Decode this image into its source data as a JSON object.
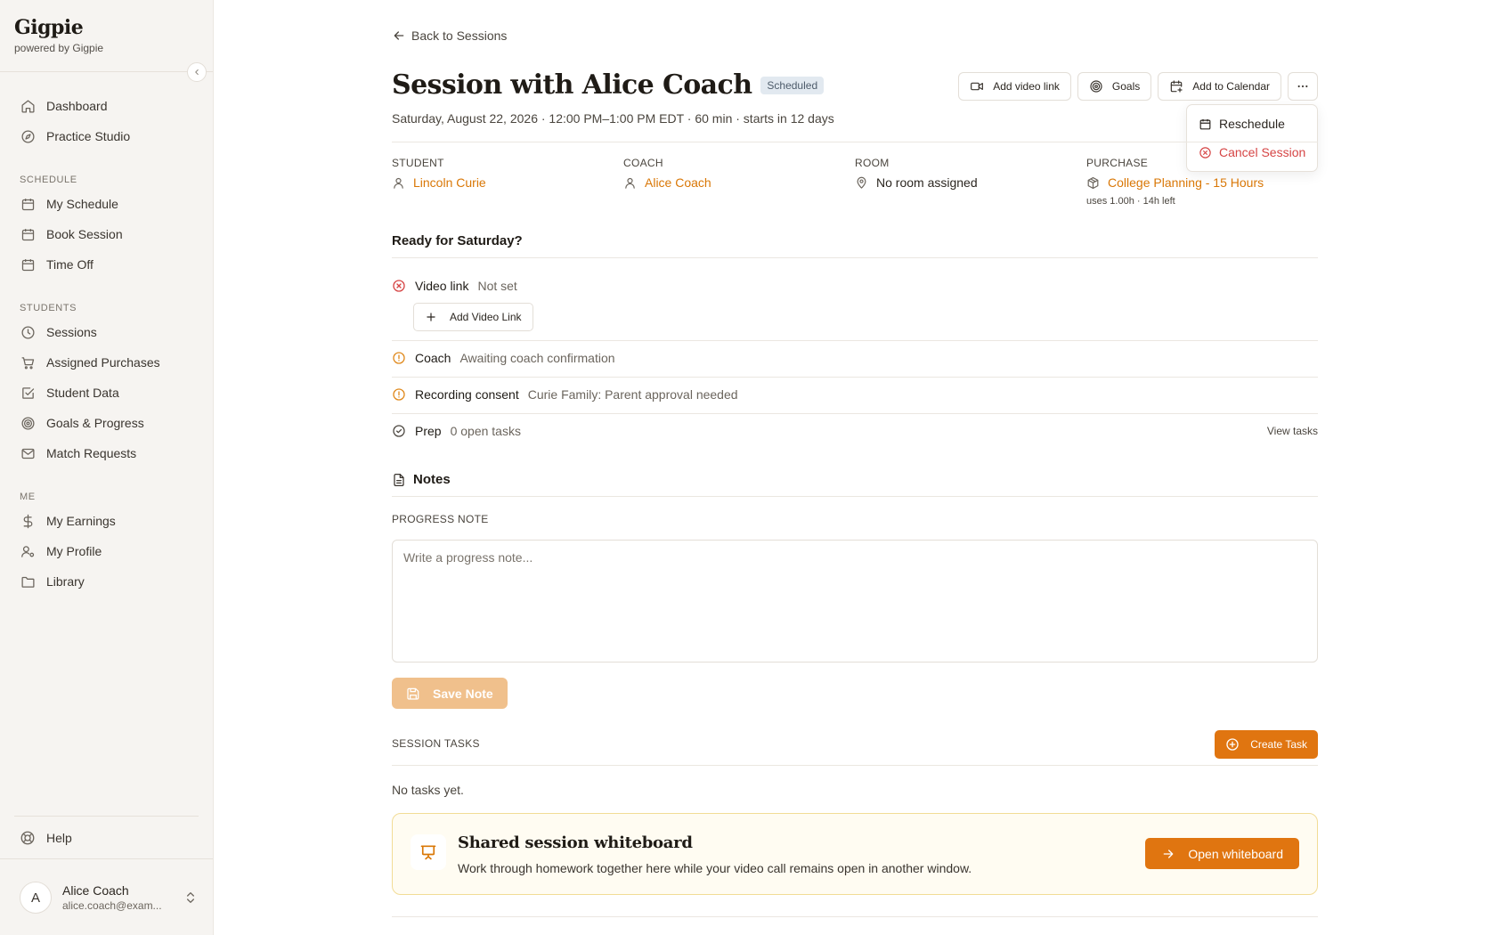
{
  "brand": {
    "name": "Gigpie",
    "sub": "powered by Gigpie"
  },
  "nav": {
    "dashboard": "Dashboard",
    "practice_studio": "Practice Studio",
    "schedule_section": "SCHEDULE",
    "my_schedule": "My Schedule",
    "book_session": "Book Session",
    "time_off": "Time Off",
    "students_section": "STUDENTS",
    "sessions": "Sessions",
    "assigned_purchases": "Assigned Purchases",
    "student_data": "Student Data",
    "goals_progress": "Goals & Progress",
    "match_requests": "Match Requests",
    "me_section": "ME",
    "my_earnings": "My Earnings",
    "my_profile": "My Profile",
    "library": "Library",
    "help": "Help"
  },
  "user": {
    "initial": "A",
    "name": "Alice Coach",
    "email": "alice.coach@exam..."
  },
  "header": {
    "back": "Back to Sessions",
    "title": "Session with Alice Coach",
    "badge": "Scheduled",
    "subtitle": "Saturday, August 22, 2026 · 12:00 PM–1:00 PM EDT · 60 min · starts in 12 days"
  },
  "actions": {
    "add_video_link": "Add video link",
    "goals": "Goals",
    "add_to_calendar": "Add to Calendar"
  },
  "menu": {
    "reschedule": "Reschedule",
    "cancel": "Cancel Session"
  },
  "meta": {
    "student_label": "STUDENT",
    "student": "Lincoln Curie",
    "coach_label": "COACH",
    "coach": "Alice Coach",
    "room_label": "ROOM",
    "room": "No room assigned",
    "purchase_label": "PURCHASE",
    "purchase": "College Planning - 15 Hours",
    "purchase_sub": "uses 1.00h · 14h left"
  },
  "readiness": {
    "title": "Ready for Saturday?",
    "video_label": "Video link",
    "video_val": "Not set",
    "add_video_link": "Add Video Link",
    "coach_label": "Coach",
    "coach_val": "Awaiting coach confirmation",
    "consent_label": "Recording consent",
    "consent_val": "Curie Family: Parent approval needed",
    "prep_label": "Prep",
    "prep_val": "0 open tasks",
    "view_tasks": "View tasks"
  },
  "notes": {
    "title": "Notes",
    "progress_label": "PROGRESS NOTE",
    "placeholder": "Write a progress note...",
    "save": "Save Note"
  },
  "tasks": {
    "label": "SESSION TASKS",
    "create": "Create Task",
    "empty": "No tasks yet."
  },
  "whiteboard": {
    "title": "Shared session whiteboard",
    "desc": "Work through homework together here while your video call remains open in another window.",
    "button": "Open whiteboard"
  },
  "colors": {
    "accent": "#e07510",
    "link": "#d97706",
    "danger": "#d64545",
    "warning": "#e08a1e"
  }
}
